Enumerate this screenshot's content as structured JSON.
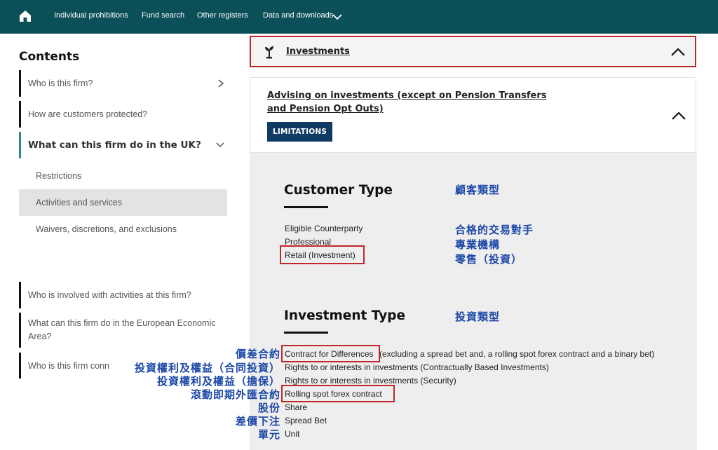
{
  "nav": {
    "items": [
      "Individual prohibitions",
      "Fund search",
      "Other registers",
      "Data and downloads"
    ]
  },
  "sidebar": {
    "title": "Contents",
    "items": [
      "Who is this firm?",
      "How are customers protected?",
      "What can this firm do in the UK?",
      "Who is involved with activities at this firm?",
      "What can this firm do in the European Economic Area?",
      "Who is this firm conn"
    ],
    "subitems": [
      "Restrictions",
      "Activities and services",
      "Waivers, discretions, and exclusions"
    ]
  },
  "main": {
    "investments_label": "Investments",
    "advising_title": "Advising on investments (except on Pension Transfers and Pension Opt Outs)",
    "limitations_badge": "LIMITATIONS",
    "customer_type": {
      "heading": "Customer Type",
      "rows": [
        "Eligible Counterparty",
        "Professional",
        "Retail (Investment)"
      ]
    },
    "investment_type": {
      "heading": "Investment Type",
      "rows": [
        "Contract for Differences",
        "(excluding a spread bet and, a rolling spot forex contract and a binary bet)",
        "Rights to or interests in investments (Contractually Based Investments)",
        "Rights to or interests in investments (Security)",
        "Rolling spot forex contract",
        "Share",
        "Spread Bet",
        "Unit"
      ]
    }
  },
  "annotations": {
    "customer_type": "顧客類型",
    "customer_rows": [
      "合格的交易對手",
      "專業機構",
      "零售（投資）"
    ],
    "investment_type": "投資類型",
    "investment_rows": [
      "價差合約",
      "投資權利及權益（合同投資）",
      "投資權利及權益（擔保）",
      "滾動即期外匯合約",
      "股份",
      "差價下注",
      "單元"
    ]
  },
  "colors": {
    "nav_bg": "#0b4f58",
    "highlight_red": "#c0272d",
    "badge_navy": "#0e3a63",
    "annotation_blue": "#1a47a8",
    "active_bar": "#2a8a8a"
  }
}
